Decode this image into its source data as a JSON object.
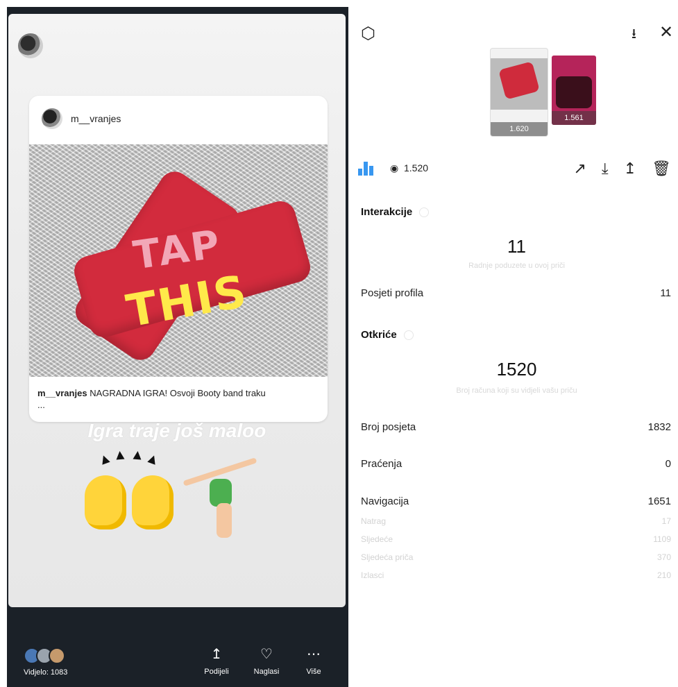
{
  "story": {
    "post": {
      "username": "m__vranjes",
      "caption_user": "m__vranjes",
      "caption_text": "NAGRADNA IGRA! Osvoji Booty band traku",
      "caption_more": "...",
      "sticker_tap": "TAP",
      "sticker_this": "THIS"
    },
    "overlay_text": "Igra traje još maloo",
    "bottom": {
      "views_label": "Vidjelo: 1083",
      "share_label": "Podijeli",
      "highlight_label": "Naglasi",
      "more_label": "Više"
    }
  },
  "insights": {
    "thumbnails": [
      {
        "count": "1.620"
      },
      {
        "count": "1.561"
      }
    ],
    "views_count": "1.520",
    "interactions": {
      "title": "Interakcije",
      "total": "11",
      "subtitle": "Radnje poduzete u ovoj priči",
      "profile_visits_label": "Posjeti profila",
      "profile_visits_value": "11"
    },
    "discovery": {
      "title": "Otkriće",
      "total": "1520",
      "subtitle": "Broj računa koji su vidjeli vašu priču",
      "visits_label": "Broj posjeta",
      "visits_value": "1832",
      "follows_label": "Praćenja",
      "follows_value": "0",
      "navigation_label": "Navigacija",
      "navigation_value": "1651",
      "nav_breakdown": [
        {
          "label": "Natrag",
          "value": "17"
        },
        {
          "label": "Sljedeće",
          "value": "1109"
        },
        {
          "label": "Sljedeća priča",
          "value": "370"
        },
        {
          "label": "Izlasci",
          "value": "210"
        }
      ]
    }
  },
  "colors": {
    "accent": "#3897f0",
    "story_bg": "#1b2128",
    "band_red": "#d22b3d",
    "sticker_yellow": "#ffe94a"
  },
  "icons": {
    "settings": "gear-icon",
    "download": "download-circle-icon",
    "close": "close-icon",
    "chart": "bar-chart-icon",
    "eye": "eye-icon",
    "trend": "trend-icon",
    "save": "download-icon",
    "share": "share-icon",
    "delete": "trash-icon"
  }
}
